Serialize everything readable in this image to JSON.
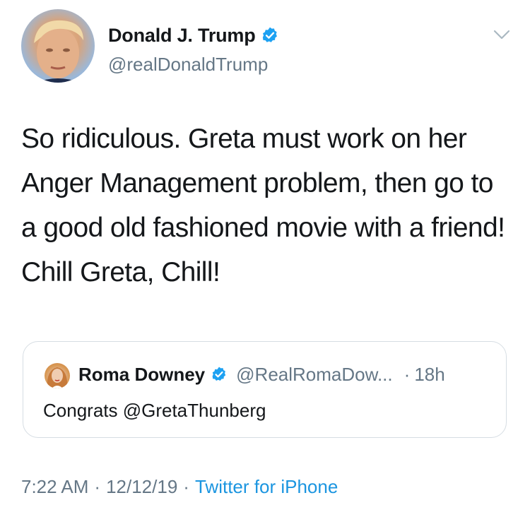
{
  "author": {
    "display_name": "Donald J. Trump",
    "handle": "@realDonaldTrump",
    "verified_icon": "verified-badge-icon",
    "avatar": "avatar"
  },
  "menu_icon": "chevron-down-icon",
  "tweet": {
    "text": "So ridiculous. Greta must work on her Anger Management problem, then go to a good old fashioned movie with a friend! Chill Greta, Chill!"
  },
  "quoted_tweet": {
    "display_name": "Roma Downey",
    "handle": "@RealRomaDow...",
    "dot": "·",
    "time": "18h",
    "text": "Congrats @GretaThunberg"
  },
  "meta": {
    "time": "7:22 AM",
    "sep1": "·",
    "date": "12/12/19",
    "sep2": "·",
    "source": "Twitter for iPhone"
  },
  "colors": {
    "verified_blue": "#1da1f2",
    "link_blue": "#1b95e0",
    "secondary_text": "#657786",
    "border": "#d6dde3"
  }
}
